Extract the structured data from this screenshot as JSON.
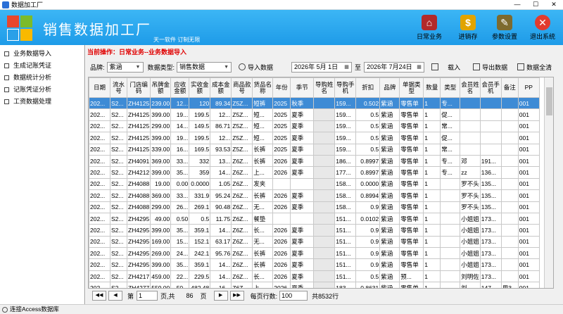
{
  "window": {
    "title": "数据加工厂",
    "controls": [
      "—",
      "☐",
      "✕"
    ]
  },
  "header": {
    "app_name": "销售数据加工厂",
    "slogan": "天一软件 订制无限",
    "toolbar": [
      {
        "label": "日常业务",
        "icon": "house-icon",
        "color": "#b22a2a",
        "glyph": "⌂"
      },
      {
        "label": "进销存",
        "icon": "coins-icon",
        "color": "#e1a400",
        "glyph": "$"
      },
      {
        "label": "参数设置",
        "icon": "tools-icon",
        "color": "#7d6a2e",
        "glyph": "✎"
      },
      {
        "label": "退出系统",
        "icon": "exit-icon",
        "color": "#e23b2e",
        "glyph": "✕"
      }
    ]
  },
  "sidebar": {
    "items": [
      {
        "label": "业务数据导入"
      },
      {
        "label": "生成记账凭证"
      },
      {
        "label": "数据统计分析"
      },
      {
        "label": "记账凭证分析"
      },
      {
        "label": "工资数据处理"
      }
    ]
  },
  "main": {
    "current_op": "当前操作：日常业务--业务数据导入",
    "brand_label": "品牌:",
    "brand_value": "紫涵",
    "type_label": "数据类型:",
    "type_value": "销售数据",
    "import_button": "导入数据",
    "date_from": "2026年 5月 1日",
    "to_label": "至",
    "date_to": "2026年 7月24日",
    "load_button": "载入",
    "export_button": "导出数据",
    "clear_button": "数据全清"
  },
  "grid": {
    "columns": [
      "日期",
      "流水号",
      "门店编码",
      "吊牌金额",
      "应收金额",
      "实收金额",
      "成本金额",
      "商品款号",
      "货品名称",
      "年份",
      "季节",
      "导购姓名",
      "导购手机",
      "折扣",
      "品牌",
      "单据类型",
      "数量",
      "类型",
      "会员姓名",
      "会员手机",
      "备注",
      "PP"
    ],
    "rows": [
      [
        "202...",
        "S2...",
        "ZH4125",
        "239.00",
        "12...",
        "120",
        "89.34",
        "Z5Z...",
        "短裤",
        "2025",
        "秋季",
        "",
        "159...",
        "0.502",
        "紫涵",
        "零售单",
        "1",
        "专...",
        "",
        "",
        "",
        "001"
      ],
      [
        "202...",
        "S2...",
        "ZH4125",
        "399.00",
        "19...",
        "199.5",
        "12...",
        "Z5Z...",
        "短...",
        "2025",
        "夏季",
        "",
        "159...",
        "0.5",
        "紫涵",
        "零售单",
        "1",
        "促...",
        "",
        "",
        "",
        "001"
      ],
      [
        "202...",
        "S2...",
        "ZH4125",
        "299.00",
        "14...",
        "149.5",
        "86.71",
        "Z5Z...",
        "短...",
        "2025",
        "夏季",
        "",
        "159...",
        "0.5",
        "紫涵",
        "零售单",
        "1",
        "常...",
        "",
        "",
        "",
        "001"
      ],
      [
        "202...",
        "S2...",
        "ZH4125",
        "399.00",
        "19...",
        "199.5",
        "12...",
        "Z5Z...",
        "短...",
        "2025",
        "夏季",
        "",
        "159...",
        "0.5",
        "紫涵",
        "零售单",
        "1",
        "促...",
        "",
        "",
        "",
        "001"
      ],
      [
        "202...",
        "S2...",
        "ZH4125",
        "339.00",
        "16...",
        "169.5",
        "93.53",
        "Z5Z...",
        "长裤",
        "2025",
        "夏季",
        "",
        "159...",
        "0.5",
        "紫涵",
        "零售单",
        "1",
        "常...",
        "",
        "",
        "",
        "001"
      ],
      [
        "202...",
        "S2...",
        "ZH4091",
        "369.00",
        "33...",
        "332",
        "13...",
        "Z6Z...",
        "长裤",
        "2026",
        "夏季",
        "",
        "186...",
        "0.8997",
        "紫涵",
        "零售单",
        "1",
        "专...",
        "邓",
        "191...",
        "",
        "001"
      ],
      [
        "202...",
        "S2...",
        "ZH4212",
        "399.00",
        "35...",
        "359",
        "14...",
        "Z6Z...",
        "上...",
        "2026",
        "夏季",
        "",
        "177...",
        "0.8997",
        "紫涵",
        "零售单",
        "1",
        "专...",
        "zz",
        "136...",
        "",
        "001"
      ],
      [
        "202...",
        "S2...",
        "ZH4088",
        "19.00",
        "0.00",
        "0.0000",
        "1.05",
        "Z6Z...",
        "发夹",
        "",
        "",
        "",
        "158...",
        "0.0000",
        "紫涵",
        "零售单",
        "1",
        "",
        "罗不头",
        "135...",
        "",
        "001"
      ],
      [
        "202...",
        "S2...",
        "ZH4088",
        "369.00",
        "33...",
        "331.9",
        "95.24",
        "Z6Z...",
        "长裤",
        "2026",
        "夏季",
        "",
        "158...",
        "0.8994",
        "紫涵",
        "零售单",
        "1",
        "",
        "罗不头",
        "135...",
        "",
        "001"
      ],
      [
        "202...",
        "S2...",
        "ZH4088",
        "299.00",
        "26...",
        "269.1",
        "90.48",
        "Z6Z...",
        "无...",
        "2026",
        "夏季",
        "",
        "158...",
        "0.9",
        "紫涵",
        "零售单",
        "1",
        "",
        "罗不头",
        "135...",
        "",
        "001"
      ],
      [
        "202...",
        "S2...",
        "ZH4295",
        "49.00",
        "0.50",
        "0.5",
        "11.75",
        "Z6Z...",
        "餐垫",
        "",
        "",
        "",
        "151...",
        "0.0102",
        "紫涵",
        "零售单",
        "1",
        "",
        "小姐姐",
        "173...",
        "",
        "001"
      ],
      [
        "202...",
        "S2...",
        "ZH4295",
        "399.00",
        "35...",
        "359.1",
        "14...",
        "Z6Z...",
        "长...",
        "2026",
        "夏季",
        "",
        "151...",
        "0.9",
        "紫涵",
        "零售单",
        "1",
        "",
        "小姐姐",
        "173...",
        "",
        "001"
      ],
      [
        "202...",
        "S2...",
        "ZH4295",
        "169.00",
        "15...",
        "152.1",
        "63.17",
        "Z6Z...",
        "无...",
        "2026",
        "夏季",
        "",
        "151...",
        "0.9",
        "紫涵",
        "零售单",
        "1",
        "",
        "小姐姐",
        "173...",
        "",
        "001"
      ],
      [
        "202...",
        "S2...",
        "ZH4295",
        "269.00",
        "24...",
        "242.1",
        "95.76",
        "Z6Z...",
        "长裤",
        "2026",
        "夏季",
        "",
        "151...",
        "0.9",
        "紫涵",
        "零售单",
        "1",
        "",
        "小姐姐",
        "173...",
        "",
        "001"
      ],
      [
        "202...",
        "S2...",
        "ZH4295",
        "399.00",
        "35...",
        "359.1",
        "14...",
        "Z6Z...",
        "长裤",
        "2026",
        "夏季",
        "",
        "151...",
        "0.9",
        "紫涵",
        "零售单",
        "1",
        "",
        "小姐姐",
        "173...",
        "",
        "001"
      ],
      [
        "202...",
        "S2...",
        "ZH4217",
        "459.00",
        "22...",
        "229.5",
        "14...",
        "Z6Z...",
        "长...",
        "2026",
        "夏季",
        "",
        "151...",
        "0.5",
        "紫涵",
        "预...",
        "1",
        "",
        "刘明佐",
        "173...",
        "",
        "001"
      ],
      [
        "202...",
        "S2...",
        "ZH4277",
        "559.00",
        "50...",
        "482.48",
        "16...",
        "Z6Z...",
        "上...",
        "2026",
        "夏季",
        "",
        "183...",
        "0.8631",
        "紫涵",
        "零售单",
        "1",
        "",
        "刘",
        "147...",
        "用3...",
        "001"
      ]
    ]
  },
  "pager": {
    "page_prefix": "第",
    "page_value": "1",
    "page_mid": "页,共",
    "total_pages": "86",
    "page_suffix": "页",
    "rows_label": "每页行数:",
    "rows_value": "100",
    "total_rows": "共8532行"
  },
  "status": {
    "text": "连接Access数据库"
  }
}
